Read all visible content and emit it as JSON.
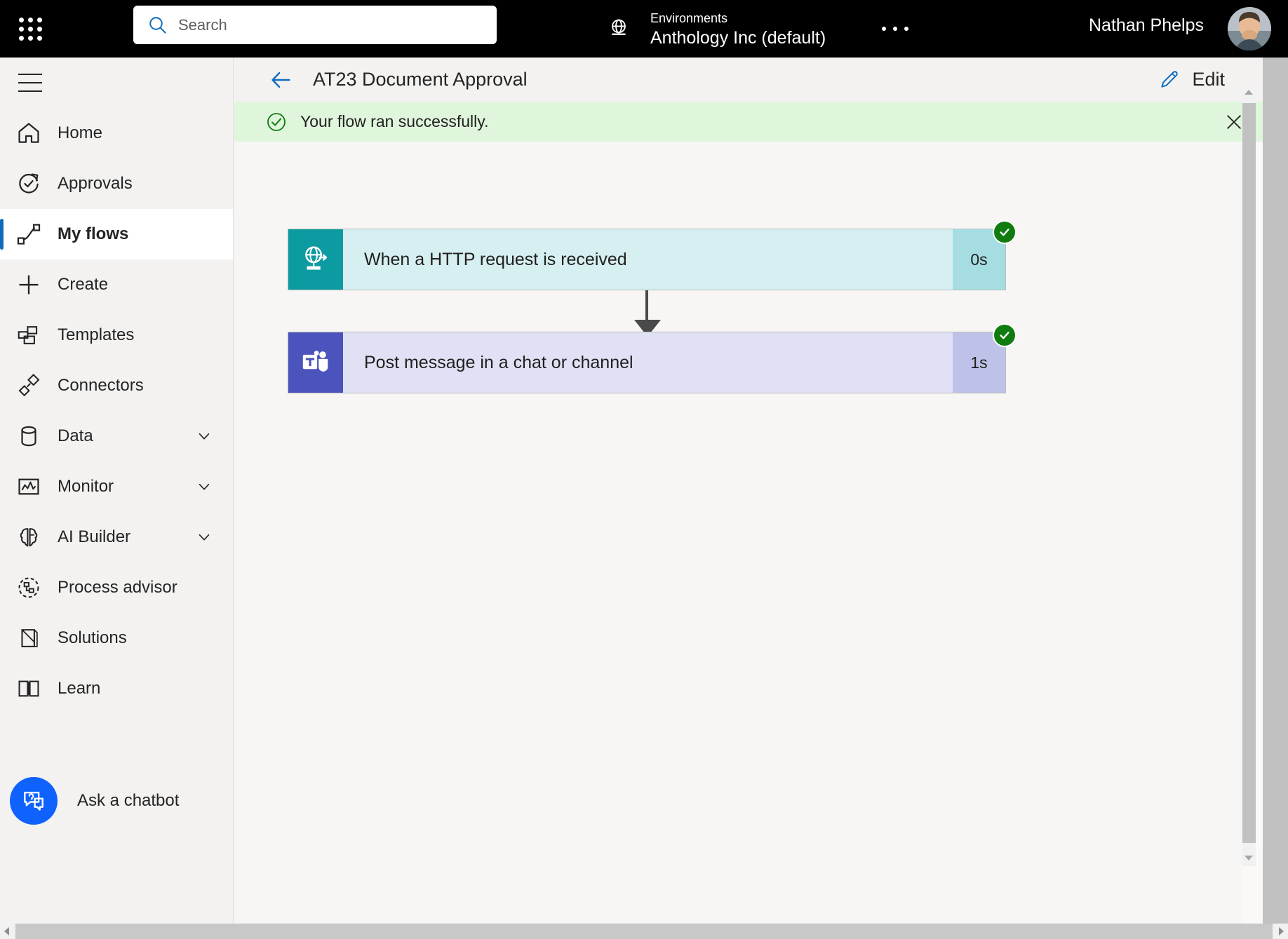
{
  "app_bar": {
    "waffle_icon": "app-launcher-icon",
    "search": {
      "icon": "search-icon",
      "placeholder": "Search",
      "value": ""
    },
    "environment": {
      "icon": "globe-icon",
      "label": "Environments",
      "value": "Anthology Inc (default)"
    },
    "more_menu": "…",
    "user": {
      "name": "Nathan Phelps",
      "avatar_icon": "user-avatar"
    }
  },
  "sidebar": {
    "menu_icon": "hamburger-menu-icon",
    "items": [
      {
        "label": "Home",
        "icon": "home-icon",
        "selected": false,
        "expandable": false
      },
      {
        "label": "Approvals",
        "icon": "approvals-clock-icon",
        "selected": false,
        "expandable": false
      },
      {
        "label": "My flows",
        "icon": "my-flows-icon",
        "selected": true,
        "expandable": false
      },
      {
        "label": "Create",
        "icon": "plus-icon",
        "selected": false,
        "expandable": false
      },
      {
        "label": "Templates",
        "icon": "templates-icon",
        "selected": false,
        "expandable": false
      },
      {
        "label": "Connectors",
        "icon": "connectors-plug-icon",
        "selected": false,
        "expandable": false
      },
      {
        "label": "Data",
        "icon": "database-icon",
        "selected": false,
        "expandable": true
      },
      {
        "label": "Monitor",
        "icon": "monitor-chart-icon",
        "selected": false,
        "expandable": true
      },
      {
        "label": "AI Builder",
        "icon": "brain-icon",
        "selected": false,
        "expandable": true
      },
      {
        "label": "Process advisor",
        "icon": "process-advisor-icon",
        "selected": false,
        "expandable": false
      },
      {
        "label": "Solutions",
        "icon": "solutions-icon",
        "selected": false,
        "expandable": false
      },
      {
        "label": "Learn",
        "icon": "book-icon",
        "selected": false,
        "expandable": false
      }
    ],
    "chatbot": {
      "label": "Ask a chatbot",
      "icon": "chatbot-question-icon",
      "color": "#0f62fe"
    }
  },
  "command_bar": {
    "back_icon": "back-arrow-icon",
    "title": "AT23 Document Approval",
    "edit": {
      "icon": "pencil-edit-icon",
      "label": "Edit"
    }
  },
  "banner": {
    "icon": "success-check-circle-icon",
    "message": "Your flow ran successfully.",
    "close_icon": "close-icon",
    "background_color": "#dff6dd"
  },
  "flow_run": {
    "steps": [
      {
        "name": "When a HTTP request is received",
        "icon": "http-request-globe-icon",
        "duration": "0s",
        "status": "succeeded",
        "status_icon": "check-circle-icon",
        "icon_color": "#0b9ba1",
        "body_color": "#d6eff1",
        "duration_color": "#a5dde2"
      },
      {
        "name": "Post message in a chat or channel",
        "icon": "microsoft-teams-icon",
        "duration": "1s",
        "status": "succeeded",
        "status_icon": "check-circle-icon",
        "icon_color": "#4b53bc",
        "body_color": "#e0e1f5",
        "duration_color": "#bfc2e8"
      }
    ],
    "connector_icon": "down-arrow-connector-icon",
    "status_color": "#107c10"
  },
  "scrollbars": {
    "vertical_inner": "content-vertical-scrollbar",
    "vertical_outer": "page-vertical-scrollbar",
    "horizontal": "page-horizontal-scrollbar"
  }
}
